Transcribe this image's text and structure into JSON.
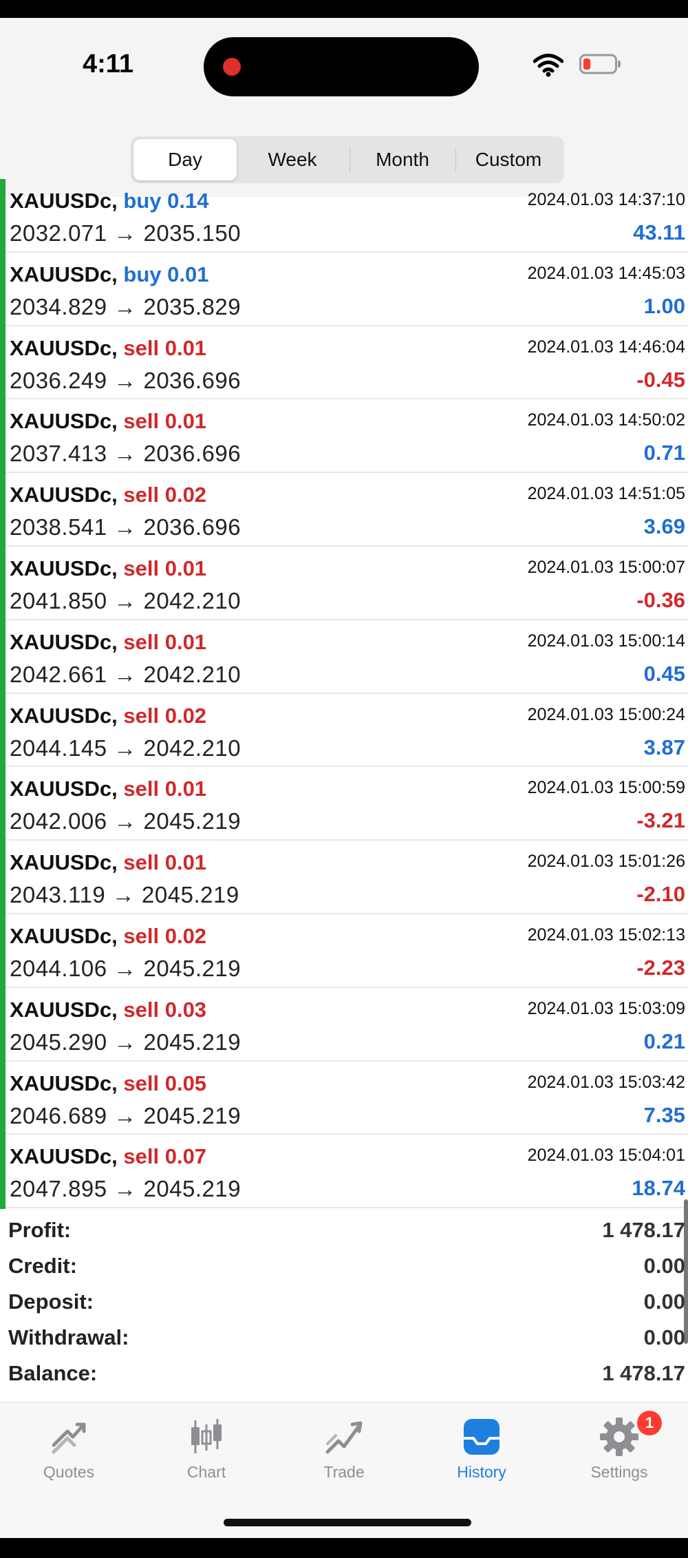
{
  "status_bar": {
    "time": "4:11"
  },
  "period_tabs": {
    "items": [
      {
        "label": "Day",
        "selected": true
      },
      {
        "label": "Week",
        "selected": false
      },
      {
        "label": "Month",
        "selected": false
      },
      {
        "label": "Custom",
        "selected": false
      }
    ]
  },
  "deals": [
    {
      "symbol": "XAUUSDc,",
      "side": "buy",
      "side_text": "buy 0.14",
      "datetime": "2024.01.03 14:37:10",
      "prices": "2032.071 → 2035.150",
      "profit": "43.11"
    },
    {
      "symbol": "XAUUSDc,",
      "side": "buy",
      "side_text": "buy 0.01",
      "datetime": "2024.01.03 14:45:03",
      "prices": "2034.829 → 2035.829",
      "profit": "1.00"
    },
    {
      "symbol": "XAUUSDc,",
      "side": "sell",
      "side_text": "sell 0.01",
      "datetime": "2024.01.03 14:46:04",
      "prices": "2036.249 → 2036.696",
      "profit": "-0.45"
    },
    {
      "symbol": "XAUUSDc,",
      "side": "sell",
      "side_text": "sell 0.01",
      "datetime": "2024.01.03 14:50:02",
      "prices": "2037.413 → 2036.696",
      "profit": "0.71"
    },
    {
      "symbol": "XAUUSDc,",
      "side": "sell",
      "side_text": "sell 0.02",
      "datetime": "2024.01.03 14:51:05",
      "prices": "2038.541 → 2036.696",
      "profit": "3.69"
    },
    {
      "symbol": "XAUUSDc,",
      "side": "sell",
      "side_text": "sell 0.01",
      "datetime": "2024.01.03 15:00:07",
      "prices": "2041.850 → 2042.210",
      "profit": "-0.36"
    },
    {
      "symbol": "XAUUSDc,",
      "side": "sell",
      "side_text": "sell 0.01",
      "datetime": "2024.01.03 15:00:14",
      "prices": "2042.661 → 2042.210",
      "profit": "0.45"
    },
    {
      "symbol": "XAUUSDc,",
      "side": "sell",
      "side_text": "sell 0.02",
      "datetime": "2024.01.03 15:00:24",
      "prices": "2044.145 → 2042.210",
      "profit": "3.87"
    },
    {
      "symbol": "XAUUSDc,",
      "side": "sell",
      "side_text": "sell 0.01",
      "datetime": "2024.01.03 15:00:59",
      "prices": "2042.006 → 2045.219",
      "profit": "-3.21"
    },
    {
      "symbol": "XAUUSDc,",
      "side": "sell",
      "side_text": "sell 0.01",
      "datetime": "2024.01.03 15:01:26",
      "prices": "2043.119 → 2045.219",
      "profit": "-2.10"
    },
    {
      "symbol": "XAUUSDc,",
      "side": "sell",
      "side_text": "sell 0.02",
      "datetime": "2024.01.03 15:02:13",
      "prices": "2044.106 → 2045.219",
      "profit": "-2.23"
    },
    {
      "symbol": "XAUUSDc,",
      "side": "sell",
      "side_text": "sell 0.03",
      "datetime": "2024.01.03 15:03:09",
      "prices": "2045.290 → 2045.219",
      "profit": "0.21"
    },
    {
      "symbol": "XAUUSDc,",
      "side": "sell",
      "side_text": "sell 0.05",
      "datetime": "2024.01.03 15:03:42",
      "prices": "2046.689 → 2045.219",
      "profit": "7.35"
    },
    {
      "symbol": "XAUUSDc,",
      "side": "sell",
      "side_text": "sell 0.07",
      "datetime": "2024.01.03 15:04:01",
      "prices": "2047.895 → 2045.219",
      "profit": "18.74"
    }
  ],
  "summary": [
    {
      "label": "Profit:",
      "value": "1 478.17"
    },
    {
      "label": "Credit:",
      "value": "0.00"
    },
    {
      "label": "Deposit:",
      "value": "0.00"
    },
    {
      "label": "Withdrawal:",
      "value": "0.00"
    },
    {
      "label": "Balance:",
      "value": "1 478.17"
    }
  ],
  "tabbar": {
    "items": [
      {
        "label": "Quotes",
        "icon": "quotes-icon",
        "active": false
      },
      {
        "label": "Chart",
        "icon": "chart-icon",
        "active": false
      },
      {
        "label": "Trade",
        "icon": "trade-icon",
        "active": false
      },
      {
        "label": "History",
        "icon": "history-icon",
        "active": true
      },
      {
        "label": "Settings",
        "icon": "settings-icon",
        "active": false,
        "badge": "1"
      }
    ]
  },
  "colors": {
    "buy": "#1f6ed4",
    "sell": "#d0282b",
    "profit_positive": "#1f6ed4",
    "profit_negative": "#d0282b",
    "accent_active": "#1f7fe0",
    "list_bar": "#1faa3a"
  }
}
